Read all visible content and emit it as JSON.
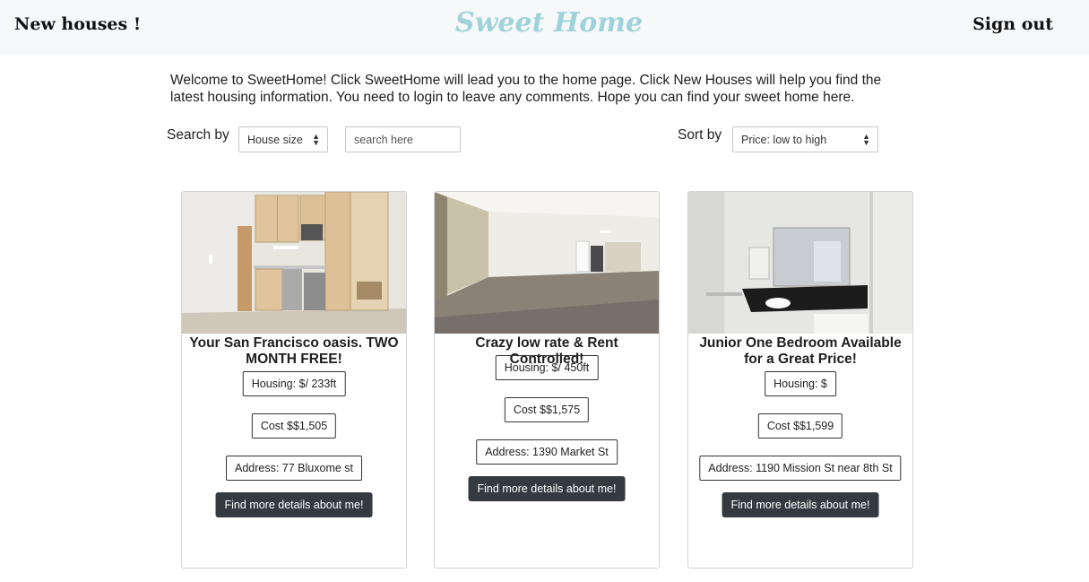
{
  "nav": {
    "left_link": "New houses !",
    "brand": "Sweet Home",
    "right_link": "Sign out"
  },
  "welcome_text": "Welcome to SweetHome! Click SweetHome will lead you to the home page. Click New Houses will help you find the latest housing information. You need to login to leave any comments. Hope you can find your sweet home here.",
  "search": {
    "label": "Search by",
    "selected": "House size",
    "placeholder": "search here"
  },
  "sort": {
    "label": "Sort by",
    "selected": "Price: low to high"
  },
  "listings": [
    {
      "title": "Your San Francisco oasis. TWO MONTH FREE!",
      "housing": "Housing: $/ 233ft",
      "cost": "Cost $$1,505",
      "address": "Address: 77 Bluxome st",
      "button": "Find more details about me!"
    },
    {
      "title": "Crazy low rate & Rent Controlled!",
      "housing": "Housing: $/ 450ft",
      "cost": "Cost $$1,575",
      "address": "Address: 1390 Market St",
      "button": "Find more details about me!"
    },
    {
      "title": "Junior One Bedroom Available for a Great Price!",
      "housing": "Housing: $",
      "cost": "Cost $$1,599",
      "address": "Address: 1190 Mission St near 8th St",
      "button": "Find more details about me!"
    }
  ],
  "colors": {
    "brand": "#9fd3db",
    "navbar_bg": "#f7f8fa",
    "button_bg": "#343a40"
  }
}
